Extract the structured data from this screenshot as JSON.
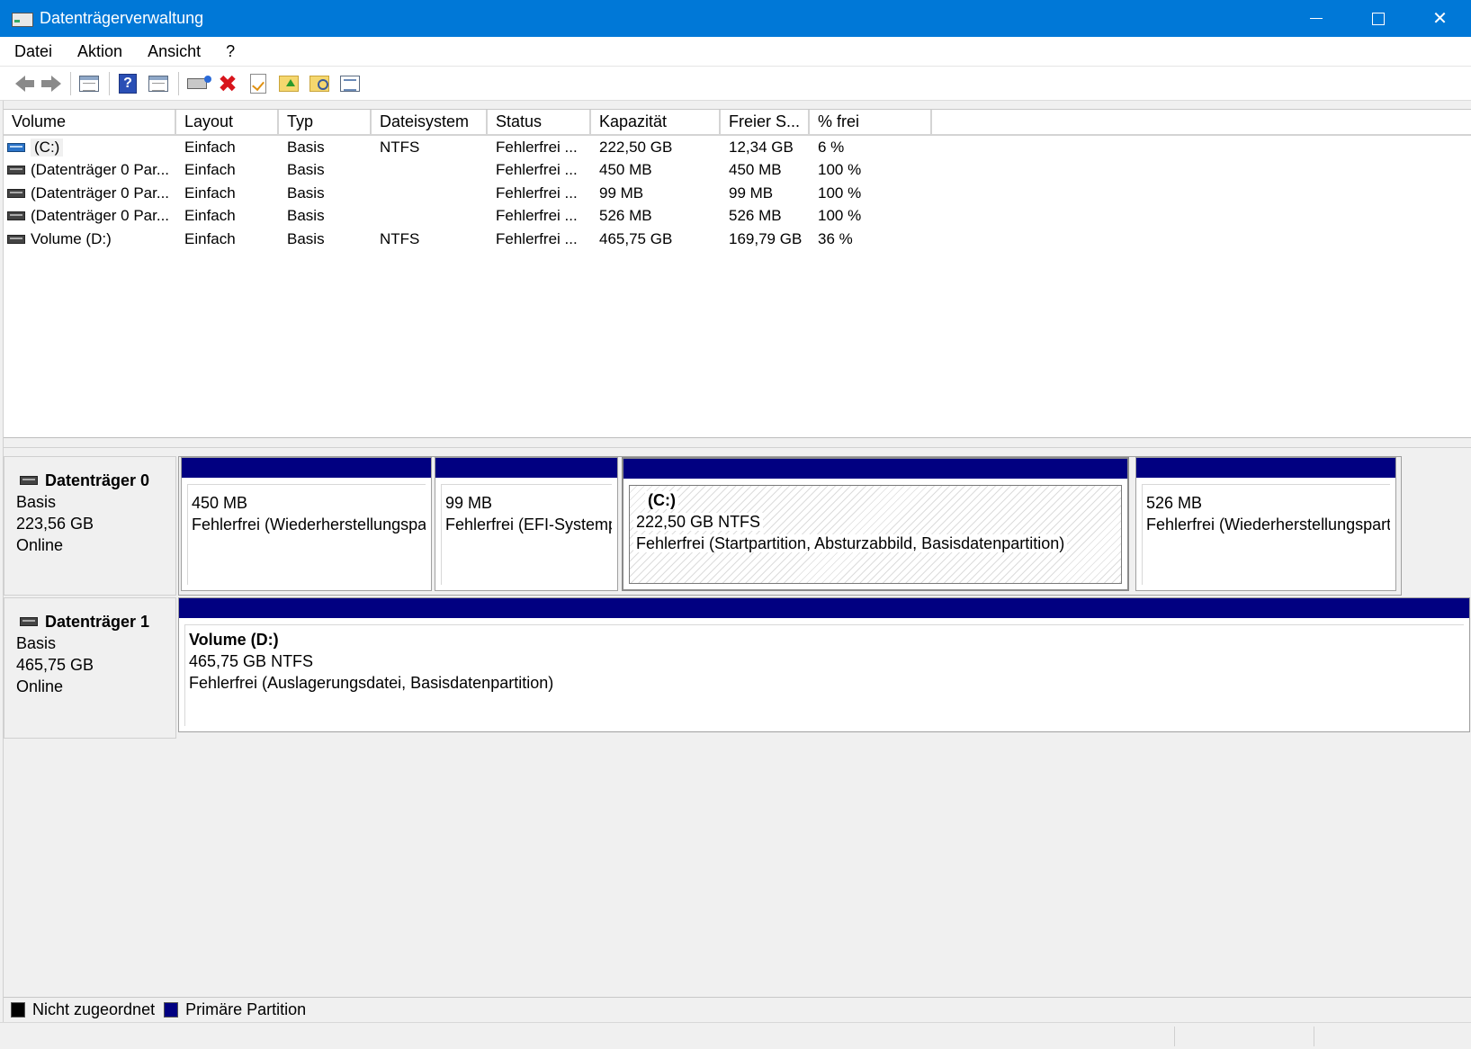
{
  "window": {
    "title": "Datenträgerverwaltung",
    "controls": {
      "minimize": "—",
      "maximize": "",
      "close": "✕"
    }
  },
  "menu": [
    "Datei",
    "Aktion",
    "Ansicht",
    "?"
  ],
  "toolbar_icons": [
    "back-arrow-icon",
    "forward-arrow-icon",
    "show-hide-console-tree-icon",
    "help-icon",
    "show-hide-action-pane-icon",
    "connect-drive-icon",
    "delete-icon",
    "properties-icon",
    "folder-up-icon",
    "folder-search-icon",
    "list-view-icon"
  ],
  "columns": [
    "Volume",
    "Layout",
    "Typ",
    "Dateisystem",
    "Status",
    "Kapazität",
    "Freier S...",
    "% frei"
  ],
  "volumes": [
    {
      "volume": "(C:)",
      "layout": "Einfach",
      "typ": "Basis",
      "fs": "NTFS",
      "status": "Fehlerfrei ...",
      "cap": "222,50 GB",
      "free": "12,34 GB",
      "pct": "6 %",
      "icon": "system-drive-icon"
    },
    {
      "volume": "(Datenträger 0 Par...",
      "layout": "Einfach",
      "typ": "Basis",
      "fs": "",
      "status": "Fehlerfrei ...",
      "cap": "450 MB",
      "free": "450 MB",
      "pct": "100 %",
      "icon": "drive-icon"
    },
    {
      "volume": "(Datenträger 0 Par...",
      "layout": "Einfach",
      "typ": "Basis",
      "fs": "",
      "status": "Fehlerfrei ...",
      "cap": "99 MB",
      "free": "99 MB",
      "pct": "100 %",
      "icon": "drive-icon"
    },
    {
      "volume": "(Datenträger 0 Par...",
      "layout": "Einfach",
      "typ": "Basis",
      "fs": "",
      "status": "Fehlerfrei ...",
      "cap": "526 MB",
      "free": "526 MB",
      "pct": "100 %",
      "icon": "drive-icon"
    },
    {
      "volume": "Volume (D:)",
      "layout": "Einfach",
      "typ": "Basis",
      "fs": "NTFS",
      "status": "Fehlerfrei ...",
      "cap": "465,75 GB",
      "free": "169,79 GB",
      "pct": "36 %",
      "icon": "drive-icon"
    }
  ],
  "disks": [
    {
      "name": "Datenträger 0",
      "type": "Basis",
      "size": "223,56 GB",
      "state": "Online",
      "partitions": [
        {
          "name": "",
          "size": "450 MB",
          "status": "Fehlerfrei (Wiederherstellungspartition)"
        },
        {
          "name": "",
          "size": "99 MB",
          "status": "Fehlerfrei (EFI-Systempartition)"
        },
        {
          "name": "(C:)",
          "size": "222,50 GB NTFS",
          "status": "Fehlerfrei (Startpartition, Absturzabbild, Basisdatenpartition)"
        },
        {
          "name": "",
          "size": "526 MB",
          "status": "Fehlerfrei (Wiederherstellungspartition)"
        }
      ]
    },
    {
      "name": "Datenträger 1",
      "type": "Basis",
      "size": "465,75 GB",
      "state": "Online",
      "partitions": [
        {
          "name": "Volume  (D:)",
          "size": "465,75 GB NTFS",
          "status": "Fehlerfrei (Auslagerungsdatei, Basisdatenpartition)"
        }
      ]
    }
  ],
  "legend": {
    "unallocated": "Nicht zugeordnet",
    "primary": "Primäre Partition"
  },
  "colors": {
    "titlebar": "#0078d7",
    "primary_partition": "#010081",
    "unallocated": "#000000"
  }
}
